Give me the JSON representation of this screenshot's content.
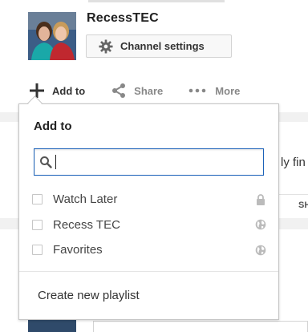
{
  "channel": {
    "name": "RecessTEC",
    "settings_label": "Channel settings"
  },
  "actions": {
    "add_to": "Add to",
    "share": "Share",
    "more": "More"
  },
  "background": {
    "peek_text": "ly fin",
    "peek_tab": "SH"
  },
  "popup": {
    "title": "Add to",
    "search": {
      "value": "",
      "placeholder": ""
    },
    "playlists": [
      {
        "name": "Watch Later",
        "checked": false,
        "privacy_icon": "lock-icon"
      },
      {
        "name": "Recess TEC",
        "checked": false,
        "privacy_icon": "globe-icon"
      },
      {
        "name": "Favorites",
        "checked": false,
        "privacy_icon": "globe-icon"
      }
    ],
    "create_label": "Create new playlist"
  },
  "colors": {
    "search_border": "#1c62b9",
    "icon_grey": "#bbbbbb"
  }
}
